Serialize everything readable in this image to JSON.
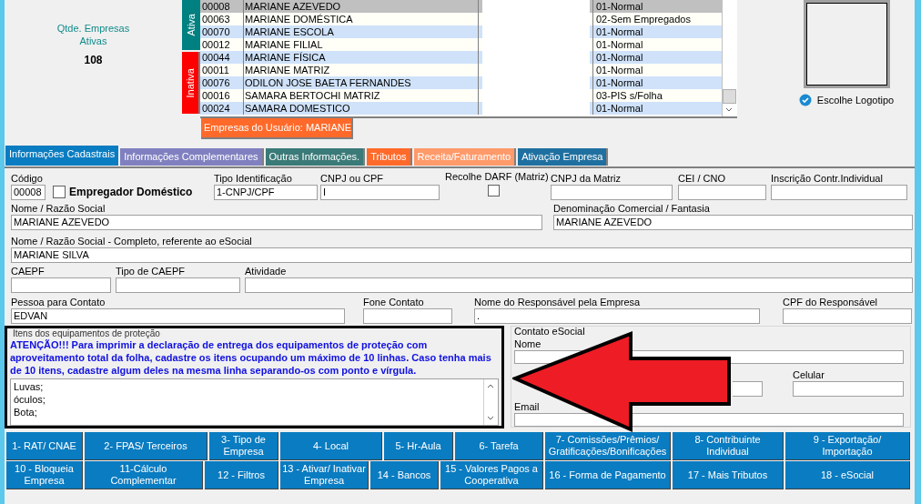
{
  "summary": {
    "label": "Qtde. Empresas Ativas",
    "count": "108"
  },
  "status_tabs": [
    {
      "label": "Ativa",
      "selected": true
    },
    {
      "label": "Inativa",
      "selected": false
    }
  ],
  "companies": [
    {
      "code": "00008",
      "name": "MARIANE AZEVEDO",
      "category": "01-Normal",
      "selected": true
    },
    {
      "code": "00063",
      "name": "MARIANE DOMÉSTICA",
      "category": "02-Sem Empregados",
      "selected": false
    },
    {
      "code": "00070",
      "name": "MARIANE ESCOLA",
      "category": "01-Normal",
      "selected": false
    },
    {
      "code": "00012",
      "name": "MARIANE FILIAL",
      "category": "01-Normal",
      "selected": false
    },
    {
      "code": "00044",
      "name": "MARIANE FÍSICA",
      "category": "01-Normal",
      "selected": false
    },
    {
      "code": "00011",
      "name": "MARIANE MATRIZ",
      "category": "01-Normal",
      "selected": false
    },
    {
      "code": "00076",
      "name": "ODILON JOSE BAETA FERNANDES",
      "category": "01-Normal",
      "selected": false
    },
    {
      "code": "00016",
      "name": "SAMARA BERTOCHI  MATRIZ",
      "category": "03-PIS s/Folha",
      "selected": false
    },
    {
      "code": "00024",
      "name": "SAMARA DOMESTICO",
      "category": "01-Normal",
      "selected": false
    }
  ],
  "user_companies_button": "Empresas do Usuário: MARIANE",
  "logo_button": "Escolhe Logotipo",
  "tabs": [
    {
      "label": "Informações Cadastrais",
      "color": "#0a7cc1",
      "selected": true
    },
    {
      "label": "Informações Complementares",
      "color": "#8080c0",
      "selected": false
    },
    {
      "label": "Outras Informações.",
      "color": "#3a7a78",
      "selected": false
    },
    {
      "label": "Tributos",
      "color": "#ff6a2a",
      "selected": false
    },
    {
      "label": "Receita/Faturamento",
      "color": "#ff9a6a",
      "selected": false
    },
    {
      "label": "Ativação Empresa",
      "color": "#1f70a0",
      "selected": false
    }
  ],
  "form_rows": [
    [
      {
        "kind": "text",
        "label": "Código",
        "value": "00008"
      },
      {
        "kind": "check_inline",
        "label": "Empregador Doméstico",
        "checked": false
      },
      {
        "kind": "text",
        "label": "Tipo Identificação",
        "value": "1-CNPJ/CPF"
      },
      {
        "kind": "text",
        "label": "CNPJ ou CPF",
        "value": "I"
      },
      {
        "kind": "check",
        "label": "Recolhe DARF (Matriz)",
        "checked": false
      },
      {
        "kind": "text",
        "label": "CNPJ da Matriz"
      },
      {
        "kind": "text",
        "label": "CEI / CNO"
      },
      {
        "kind": "text",
        "label": "Inscrição Contr.Individual"
      }
    ],
    [
      {
        "kind": "text",
        "label": "Nome / Razão Social",
        "value": "MARIANE AZEVEDO"
      },
      {
        "kind": "text",
        "label": "Denominação Comercial / Fantasia",
        "value": "MARIANE AZEVEDO"
      }
    ],
    [
      {
        "kind": "text",
        "label": "Nome / Razão Social - Completo, referente ao eSocial",
        "value": "MARIANE SILVA"
      }
    ],
    [
      {
        "kind": "text",
        "label": "CAEPF"
      },
      {
        "kind": "text",
        "label": "Tipo de CAEPF"
      },
      {
        "kind": "text",
        "label": "Atividade"
      }
    ],
    [
      {
        "kind": "text",
        "label": "Pessoa para Contato",
        "value": "EDVAN"
      },
      {
        "kind": "text",
        "label": "Fone Contato"
      },
      {
        "kind": "text",
        "label": "Nome do Responsável pela Empresa",
        "value": "."
      },
      {
        "kind": "text",
        "label": "CPF do Responsável"
      }
    ]
  ],
  "equipment": {
    "title": "Itens dos equipamentos de proteção",
    "notice": "ATENÇÃO!!! Para imprimir a declaração de entrega dos equipamentos de proteção com aproveitamento total da folha, cadastre os itens ocupando um máximo de 10 linhas. Caso tenha mais de 10 itens, cadastre algum deles na mesma linha separando-os com ponto e vírgula.",
    "items": [
      "Luvas;",
      "óculos;",
      "Bota;"
    ]
  },
  "esocial_contact": {
    "title": "Contato eSocial",
    "name_label": "Nome",
    "mobile_label": "Celular",
    "email_label": "Email"
  },
  "buttons": [
    [
      "1- RAT/ CNAE",
      "2- FPAS/ Terceiros",
      "3- Tipo de Empresa",
      "4- Local",
      "5- Hr-Aula",
      "6- Tarefa",
      "7- Comissões/Prêmios/ Gratificações/Bonificações",
      "8- Contribuinte Individual",
      "9 - Exportação/ Importação"
    ],
    [
      "10 - Bloqueia Empresa",
      "11-Cálculo Complementar",
      "12 - Filtros",
      "13 - Ativar/ Inativar Empresa",
      "14 - Bancos",
      "15 - Valores Pagos a Cooperativa",
      "16 - Forma de Pagamento",
      "17 - Mais Tributos",
      "18 - eSocial"
    ]
  ]
}
